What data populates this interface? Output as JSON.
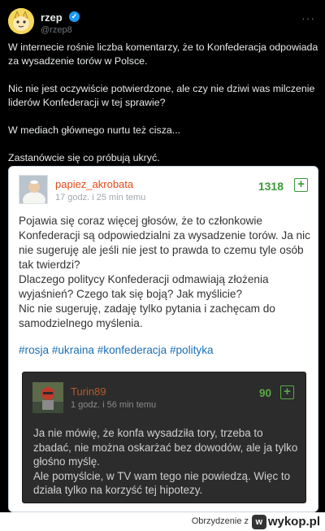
{
  "tweet": {
    "name": "rzep",
    "handle": "@rzep8",
    "more": "···",
    "paragraphs": [
      "W internecie rośnie liczba komentarzy, że to Konfederacja odpowiada za wysadzenie torów w Polsce.",
      "Nic nie jest oczywiście potwierdzone, ale czy nie dziwi was milczenie liderów Konfederacji w tej sprawie?",
      "W mediach głównego nurtu też cisza...",
      "Zastanówcie się co próbują ukryć."
    ]
  },
  "post": {
    "username": "papiez_akrobata",
    "time": "17 godz. i 25 min temu",
    "votes": "1318",
    "plus": "+",
    "body_lines": [
      "Pojawia się coraz więcej głosów, że to członkowie Konfederacji są odpowiedzialni za wysadzenie torów. Ja nic nie sugeruję ale jeśli nie jest to prawda to czemu tyle osób tak twierdzi?",
      "Dlaczego politycy Konfederacji odmawiają złożenia wyjaśnień? Czego tak się boją? Jak myślicie?",
      "Nic nie sugeruję, zadaję tylko pytania i zachęcam do samodzielnego myślenia."
    ],
    "tags": [
      "#rosja",
      "#ukraina",
      "#konfederacja",
      "#polityka"
    ]
  },
  "reply": {
    "username": "Turin89",
    "time": "1 godz. i 56 min temu",
    "votes": "90",
    "plus": "+",
    "body_lines": [
      "Ja nie mówię, że konfa wysadziła tory, trzeba to zbadać, nie można oskarżać bez dowodów, ale ja tylko głośno myślę.",
      "Ale pomyślcie, w TV wam tego nie powiedzą. Więc to działa tylko na korzyść tej hipotezy."
    ]
  },
  "footer": {
    "text": "Obrzydzenie z",
    "logo_glyph": "w",
    "logo_word": "wykop.pl"
  }
}
